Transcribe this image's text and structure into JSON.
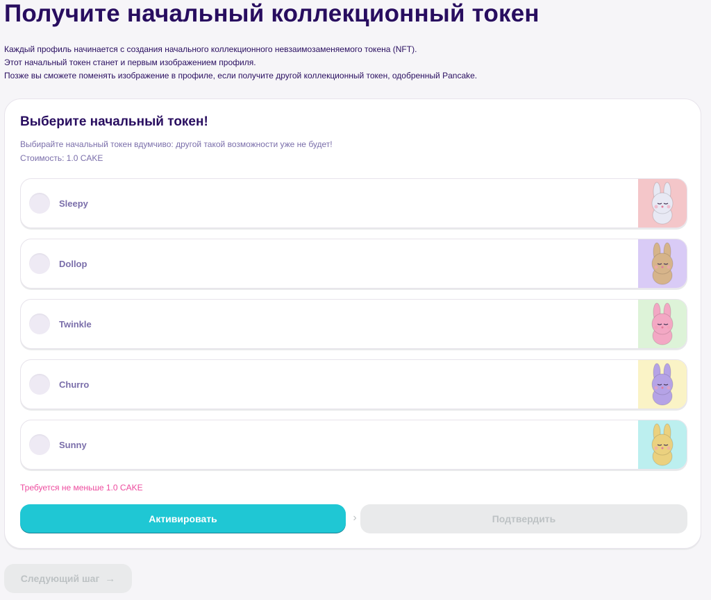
{
  "page": {
    "title": "Получите начальный коллекционный токен",
    "intro": [
      "Каждый профиль начинается с создания начального коллекционного невзаимозаменяемого токена (NFT).",
      "Этот начальный токен станет и первым изображением профиля.",
      "Позже вы сможете поменять изображение в профиле, если получите другой коллекционный токен, одобренный Pancake."
    ]
  },
  "card": {
    "title": "Выберите начальный токен!",
    "subtitle": "Выбирайте начальный токен вдумчиво: другой такой возможности уже не будет!",
    "cost": "Стоимость: 1.0 CAKE",
    "options": [
      {
        "label": "Sleepy",
        "bg": "#F4C6C9",
        "accent": "#E8E9F4"
      },
      {
        "label": "Dollop",
        "bg": "#D9CBF6",
        "accent": "#D6B48A"
      },
      {
        "label": "Twinkle",
        "bg": "#DDF3D8",
        "accent": "#F3A8C4"
      },
      {
        "label": "Churro",
        "bg": "#FAF3C6",
        "accent": "#B5A3E6"
      },
      {
        "label": "Sunny",
        "bg": "#BCEFEF",
        "accent": "#EBD17F"
      }
    ],
    "error": "Требуется не меньше 1.0 CAKE",
    "activate_label": "Активировать",
    "confirm_label": "Подтвердить"
  },
  "footer": {
    "next_label": "Следующий шаг",
    "next_icon": "arrow-right-icon"
  },
  "colors": {
    "primary": "#1FC7D4",
    "text": "#280D5F",
    "text_subtle": "#7A6EAA",
    "failure": "#ED4B9E",
    "disabled_bg": "#E9EAEB",
    "disabled_text": "#BDC2C4"
  }
}
